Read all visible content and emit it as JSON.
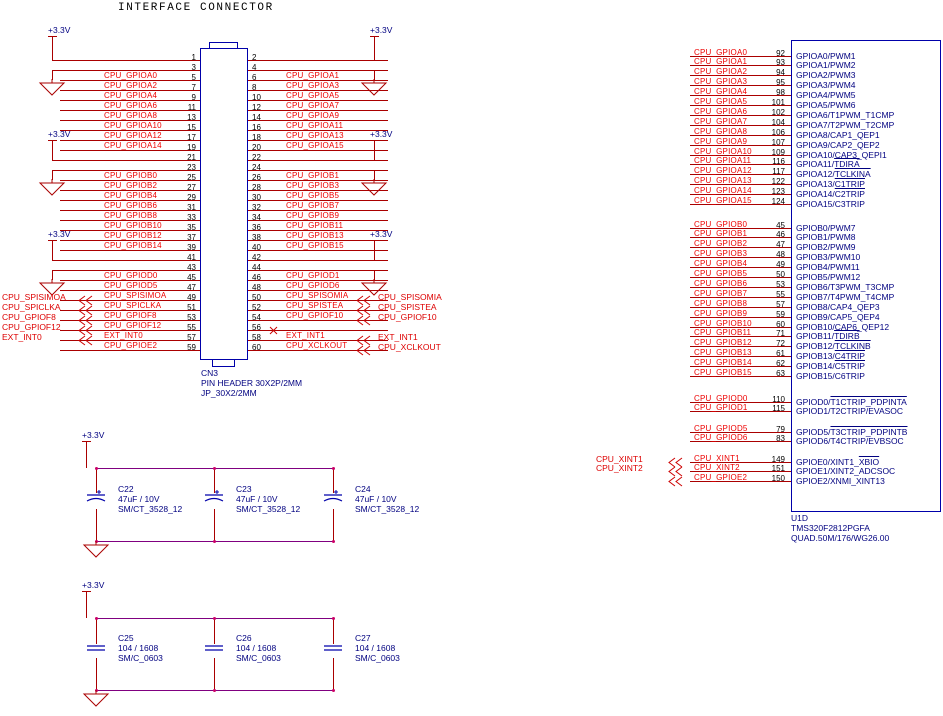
{
  "sheet": {
    "title": "INTERFACE CONNECTOR",
    "power_label": "+3.3V"
  },
  "connector": {
    "refdes": "CN3",
    "desc1": "PIN HEADER 30X2P/2MM",
    "desc2": "JP_30X2/2MM",
    "left_pins": [
      {
        "num": "1",
        "net": ""
      },
      {
        "num": "3",
        "net": ""
      },
      {
        "num": "5",
        "net": "CPU_GPIOA0"
      },
      {
        "num": "7",
        "net": "CPU_GPIOA2"
      },
      {
        "num": "9",
        "net": "CPU_GPIOA4"
      },
      {
        "num": "11",
        "net": "CPU_GPIOA6"
      },
      {
        "num": "13",
        "net": "CPU_GPIOA8"
      },
      {
        "num": "15",
        "net": "CPU_GPIOA10"
      },
      {
        "num": "17",
        "net": "CPU_GPIOA12"
      },
      {
        "num": "19",
        "net": "CPU_GPIOA14"
      },
      {
        "num": "21",
        "net": ""
      },
      {
        "num": "23",
        "net": ""
      },
      {
        "num": "25",
        "net": "CPU_GPIOB0"
      },
      {
        "num": "27",
        "net": "CPU_GPIOB2"
      },
      {
        "num": "29",
        "net": "CPU_GPIOB4"
      },
      {
        "num": "31",
        "net": "CPU_GPIOB6"
      },
      {
        "num": "33",
        "net": "CPU_GPIOB8"
      },
      {
        "num": "35",
        "net": "CPU_GPIOB10"
      },
      {
        "num": "37",
        "net": "CPU_GPIOB12"
      },
      {
        "num": "39",
        "net": "CPU_GPIOB14"
      },
      {
        "num": "41",
        "net": ""
      },
      {
        "num": "43",
        "net": ""
      },
      {
        "num": "45",
        "net": "CPU_GPIOD0"
      },
      {
        "num": "47",
        "net": "CPU_GPIOD5"
      },
      {
        "num": "49",
        "net": "CPU_SPISIMOA"
      },
      {
        "num": "51",
        "net": "CPU_SPICLKA"
      },
      {
        "num": "53",
        "net": "CPU_GPIOF8"
      },
      {
        "num": "55",
        "net": "CPU_GPIOF12"
      },
      {
        "num": "57",
        "net": "EXT_INT0"
      },
      {
        "num": "59",
        "net": "CPU_GPIOE2"
      }
    ],
    "right_pins": [
      {
        "num": "2",
        "net": ""
      },
      {
        "num": "4",
        "net": ""
      },
      {
        "num": "6",
        "net": "CPU_GPIOA1"
      },
      {
        "num": "8",
        "net": "CPU_GPIOA3"
      },
      {
        "num": "10",
        "net": "CPU_GPIOA5"
      },
      {
        "num": "12",
        "net": "CPU_GPIOA7"
      },
      {
        "num": "14",
        "net": "CPU_GPIOA9"
      },
      {
        "num": "16",
        "net": "CPU_GPIOA11"
      },
      {
        "num": "18",
        "net": "CPU_GPIOA13"
      },
      {
        "num": "20",
        "net": "CPU_GPIOA15"
      },
      {
        "num": "22",
        "net": ""
      },
      {
        "num": "24",
        "net": ""
      },
      {
        "num": "26",
        "net": "CPU_GPIOB1"
      },
      {
        "num": "28",
        "net": "CPU_GPIOB3"
      },
      {
        "num": "30",
        "net": "CPU_GPIOB5"
      },
      {
        "num": "32",
        "net": "CPU_GPIOB7"
      },
      {
        "num": "34",
        "net": "CPU_GPIOB9"
      },
      {
        "num": "36",
        "net": "CPU_GPIOB11"
      },
      {
        "num": "38",
        "net": "CPU_GPIOB13"
      },
      {
        "num": "40",
        "net": "CPU_GPIOB15"
      },
      {
        "num": "42",
        "net": ""
      },
      {
        "num": "44",
        "net": ""
      },
      {
        "num": "46",
        "net": "CPU_GPIOD1"
      },
      {
        "num": "48",
        "net": "CPU_GPIOD6"
      },
      {
        "num": "50",
        "net": "CPU_SPISOMIA"
      },
      {
        "num": "52",
        "net": "CPU_SPISTEA"
      },
      {
        "num": "54",
        "net": "CPU_GPIOF10"
      },
      {
        "num": "56",
        "net": ""
      },
      {
        "num": "58",
        "net": "EXT_INT1"
      },
      {
        "num": "60",
        "net": "CPU_XCLKOUT"
      }
    ]
  },
  "left_netlabels": [
    "CPU_SPISIMOA",
    "CPU_SPICLKA",
    "CPU_GPIOF8",
    "CPU_GPIOF12",
    "EXT_INT0"
  ],
  "right_netlabels_a": [
    "CPU_SPISOMIA",
    "CPU_SPISTEA",
    "CPU_GPIOF10"
  ],
  "right_netlabels_b": [
    "EXT_INT1",
    "CPU_XCLKOUT"
  ],
  "u1d": {
    "refdes": "U1D",
    "part": "TMS320F2812PGFA",
    "package": "QUAD.50M/176/WG26.00",
    "groups": [
      {
        "rows": [
          {
            "net": "CPU_GPIOA0",
            "num": "92",
            "name": "GPIOA0/PWM1"
          },
          {
            "net": "CPU_GPIOA1",
            "num": "93",
            "name": "GPIOA1/PWM2"
          },
          {
            "net": "CPU_GPIOA2",
            "num": "94",
            "name": "GPIOA2/PWM3"
          },
          {
            "net": "CPU_GPIOA3",
            "num": "95",
            "name": "GPIOA3/PWM4"
          },
          {
            "net": "CPU_GPIOA4",
            "num": "98",
            "name": "GPIOA4/PWM5"
          },
          {
            "net": "CPU_GPIOA5",
            "num": "101",
            "name": "GPIOA5/PWM6"
          },
          {
            "net": "CPU_GPIOA6",
            "num": "102",
            "name": "GPIOA6/T1PWM_T1CMP"
          },
          {
            "net": "CPU_GPIOA7",
            "num": "104",
            "name": "GPIOA7/T2PWM_T2CMP"
          },
          {
            "net": "CPU_GPIOA8",
            "num": "106",
            "name": "GPIOA8/CAP1_QEP1"
          },
          {
            "net": "CPU_GPIOA9",
            "num": "107",
            "name": "GPIOA9/CAP2_QEP2"
          },
          {
            "net": "CPU_GPIOA10",
            "num": "109",
            "name": "GPIOA10/CAP3_QEPI1"
          },
          {
            "net": "CPU_GPIOA11",
            "num": "116",
            "name": "GPIOA11/TDIRA"
          },
          {
            "net": "CPU_GPIOA12",
            "num": "117",
            "name": "GPIOA12/TCLKINA"
          },
          {
            "net": "CPU_GPIOA13",
            "num": "122",
            "name": "GPIOA13/C1TRIP"
          },
          {
            "net": "CPU_GPIOA14",
            "num": "123",
            "name": "GPIOA14/C2TRIP"
          },
          {
            "net": "CPU_GPIOA15",
            "num": "124",
            "name": "GPIOA15/C3TRIP"
          }
        ]
      },
      {
        "rows": [
          {
            "net": "CPU_GPIOB0",
            "num": "45",
            "name": "GPIOB0/PWM7"
          },
          {
            "net": "CPU_GPIOB1",
            "num": "46",
            "name": "GPIOB1/PWM8"
          },
          {
            "net": "CPU_GPIOB2",
            "num": "47",
            "name": "GPIOB2/PWM9"
          },
          {
            "net": "CPU_GPIOB3",
            "num": "48",
            "name": "GPIOB3/PWM10"
          },
          {
            "net": "CPU_GPIOB4",
            "num": "49",
            "name": "GPIOB4/PWM11"
          },
          {
            "net": "CPU_GPIOB5",
            "num": "50",
            "name": "GPIOB5/PWM12"
          },
          {
            "net": "CPU_GPIOB6",
            "num": "53",
            "name": "GPIOB6/T3PWM_T3CMP"
          },
          {
            "net": "CPU_GPIOB7",
            "num": "55",
            "name": "GPIOB7/T4PWM_T4CMP"
          },
          {
            "net": "CPU_GPIOB8",
            "num": "57",
            "name": "GPIOB8/CAP4_QEP3"
          },
          {
            "net": "CPU_GPIOB9",
            "num": "59",
            "name": "GPIOB9/CAP5_QEP4"
          },
          {
            "net": "CPU_GPIOB10",
            "num": "60",
            "name": "GPIOB10/CAP6_QEP12"
          },
          {
            "net": "CPU_GPIOB11",
            "num": "71",
            "name": "GPIOB11/TDIRB"
          },
          {
            "net": "CPU_GPIOB12",
            "num": "72",
            "name": "GPIOB12/TCLKINB"
          },
          {
            "net": "CPU_GPIOB13",
            "num": "61",
            "name": "GPIOB13/C4TRIP"
          },
          {
            "net": "CPU_GPIOB14",
            "num": "62",
            "name": "GPIOB14/C5TRIP"
          },
          {
            "net": "CPU_GPIOB15",
            "num": "63",
            "name": "GPIOB15/C6TRIP"
          }
        ]
      },
      {
        "rows": [
          {
            "net": "CPU_GPIOD0",
            "num": "110",
            "name": "GPIOD0/T1CTRIP_PDPINTA"
          },
          {
            "net": "CPU_GPIOD1",
            "num": "115",
            "name": "GPIOD1/T2CTRIP/EVASOC"
          }
        ]
      },
      {
        "rows": [
          {
            "net": "CPU_GPIOD5",
            "num": "79",
            "name": "GPIOD5/T3CTRIP_PDPINTB"
          },
          {
            "net": "CPU_GPIOD6",
            "num": "83",
            "name": "GPIOD6/T4CTRIP/EVBSOC"
          }
        ]
      },
      {
        "rows": [
          {
            "net": "CPU_XINT1",
            "num": "149",
            "name": "GPIOE0/XINT1_XBIO"
          },
          {
            "net": "CPU_XINT2",
            "num": "151",
            "name": "GPIOE1/XINT2_ADCSOC"
          },
          {
            "net": "CPU_GPIOE2",
            "num": "150",
            "name": "GPIOE2/XNMI_XINT13"
          }
        ]
      }
    ],
    "external_labels": [
      "CPU_XINT1",
      "CPU_XINT2"
    ]
  },
  "caps_top": [
    {
      "ref": "C22",
      "value": "47uF / 10V",
      "footprint": "SM/CT_3528_12"
    },
    {
      "ref": "C23",
      "value": "47uF / 10V",
      "footprint": "SM/CT_3528_12"
    },
    {
      "ref": "C24",
      "value": "47uF / 10V",
      "footprint": "SM/CT_3528_12"
    }
  ],
  "caps_bottom": [
    {
      "ref": "C25",
      "value": "104 / 1608",
      "footprint": "SM/C_0603"
    },
    {
      "ref": "C26",
      "value": "104 / 1608",
      "footprint": "SM/C_0603"
    },
    {
      "ref": "C27",
      "value": "104 / 1608",
      "footprint": "SM/C_0603"
    }
  ],
  "colors": {
    "wire_red": "#aa0000",
    "wire_blue": "#000080",
    "net_text": "#ee0000",
    "pin_text": "#000080",
    "junction": "#cc0066"
  }
}
